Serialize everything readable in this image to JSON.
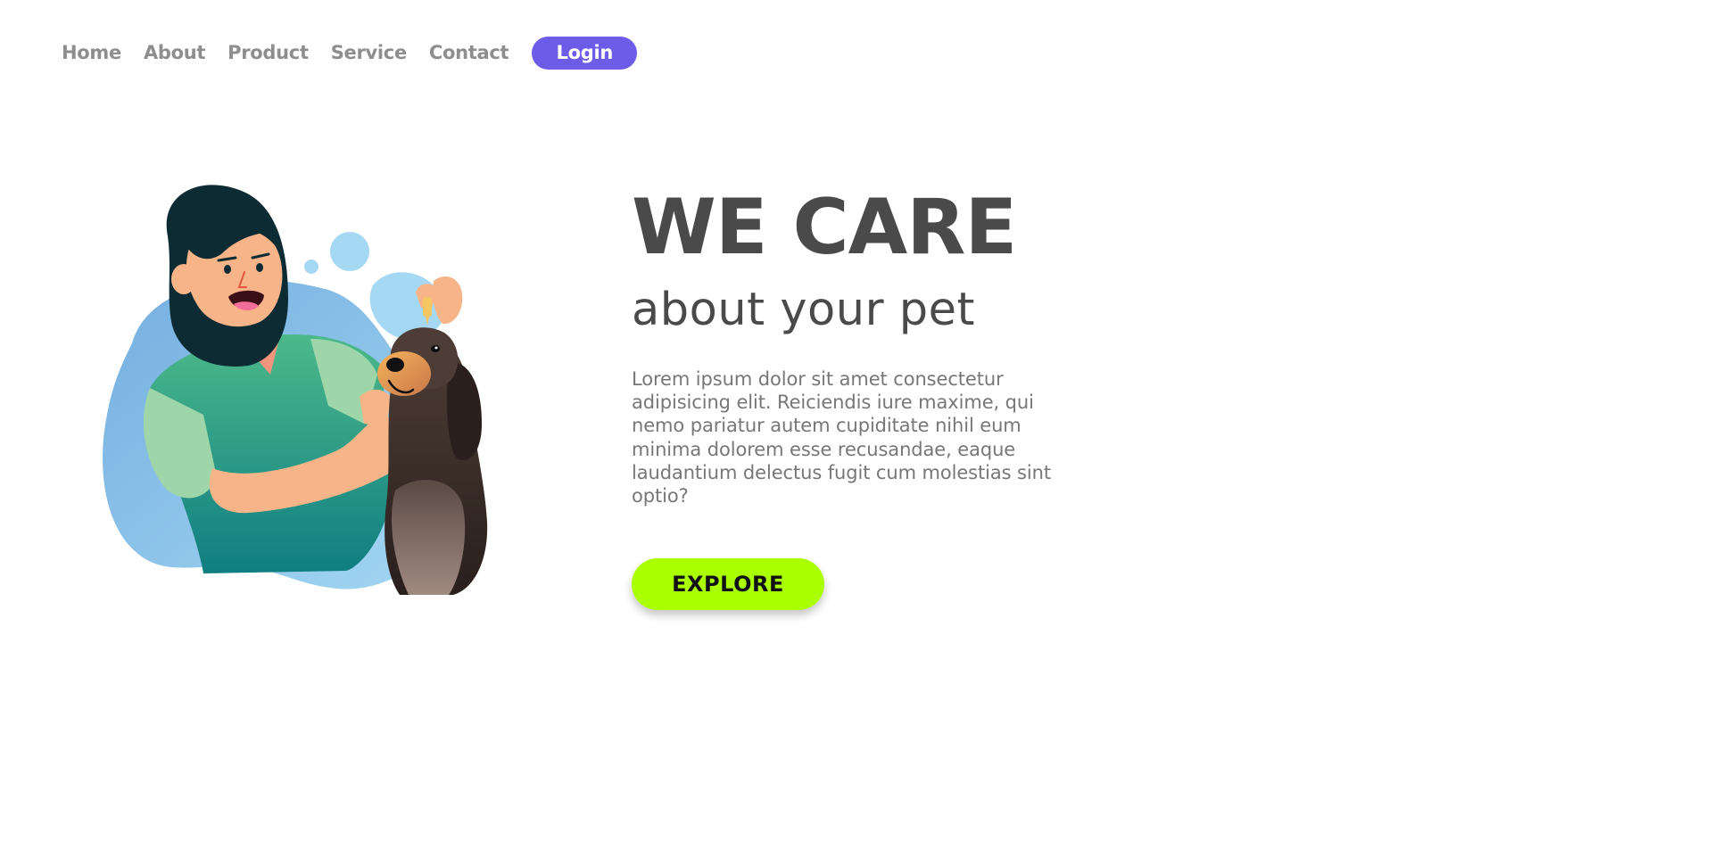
{
  "nav": {
    "links": [
      {
        "label": "Home"
      },
      {
        "label": "About"
      },
      {
        "label": "Product"
      },
      {
        "label": "Service"
      },
      {
        "label": "Contact"
      }
    ],
    "login_label": "Login"
  },
  "hero": {
    "title": "WE CARE",
    "subtitle": "about your pet",
    "description": "Lorem ipsum dolor sit amet consectetur adipisicing elit. Reiciendis iure maxime, qui nemo pariatur autem cupiditate nihil eum minima dolorem esse recusandae, eaque laudantium delectus fugit cum molestias sint optio?",
    "cta_label": "EXPLORE"
  },
  "colors": {
    "accent": "#6c5ce7",
    "cta": "#aaff00",
    "heading": "#4a4a4a",
    "nav_text": "#8e8e8e",
    "body_text": "#777777"
  },
  "illustration": {
    "icon": "woman-with-dog-illustration"
  }
}
